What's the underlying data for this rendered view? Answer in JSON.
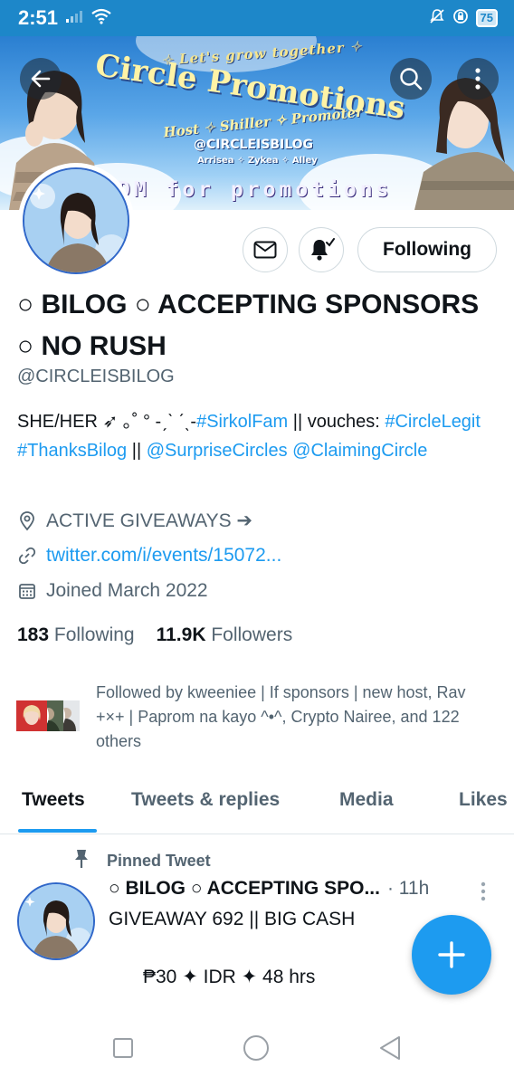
{
  "status_bar": {
    "time": "2:51",
    "battery": "75",
    "icons": [
      "signal-icon",
      "wifi-icon",
      "mute-icon",
      "data-saver-icon",
      "battery-icon"
    ]
  },
  "banner": {
    "tagline": "✧ Let's grow together ✧",
    "title": "Circle Promotions",
    "subtitle": "Host ✧ Shiller ✧ Promoter",
    "handle": "@CIRCLEISBILOG",
    "names": "Arrisea ✧ Zykea ✧ Alley",
    "cta": "DM for promotions"
  },
  "profile": {
    "display_name": "○ BILOG ○ ACCEPTING SPONSORS ○ NO RUSH",
    "handle": "@CIRCLEISBILOG",
    "bio_parts": {
      "t1": "SHE/HER ➶ ｡˚ ° -ˏˋ ˊˎ-",
      "l1": "#SirkolFam",
      "t2": " || vouches: ",
      "l2": "#CircleLegit",
      "t3": " ",
      "l3": "#ThanksBilog",
      "t4": " || ",
      "l4": "@SurpriseCircles",
      "t5": " ",
      "l5": "@ClaimingCircle"
    },
    "location": "ACTIVE GIVEAWAYS ➔",
    "url": "twitter.com/i/events/15072...",
    "joined": "Joined March 2022",
    "following_count": "183",
    "following_label": "Following",
    "followers_count": "11.9K",
    "followers_label": "Followers",
    "followed_by": "Followed by kweeniee | If sponsors | new host, Rav +×+ | Paprom na kayo ^•^, Crypto Nairee, and 122 others",
    "following_button": "Following"
  },
  "tabs": [
    {
      "label": "Tweets",
      "active": true
    },
    {
      "label": "Tweets & replies",
      "active": false
    },
    {
      "label": "Media",
      "active": false
    },
    {
      "label": "Likes",
      "active": false
    }
  ],
  "pinned_tweet": {
    "pinned_label": "Pinned Tweet",
    "author": "○ BILOG ○ ACCEPTING SPO...",
    "time": "· 11h",
    "line1": "GIVEAWAY 692 || BIG CASH",
    "line2": "₱30 ✦ IDR ✦ 48 hrs"
  },
  "colors": {
    "accent": "#1d9bf0",
    "status_bar": "#1d87c9",
    "secondary_text": "#536471",
    "primary_text": "#0f1419"
  }
}
